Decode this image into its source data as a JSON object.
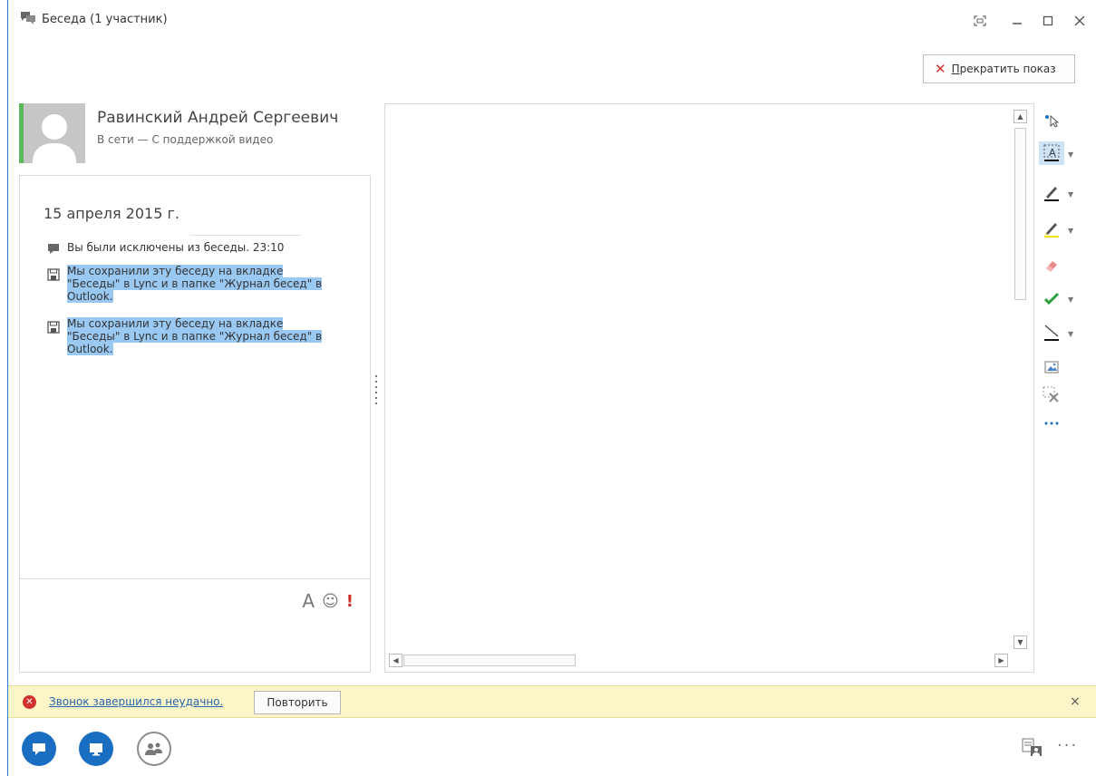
{
  "window": {
    "title": "Беседа (1 участник)"
  },
  "header": {
    "stop_presenting_label": "Прекратить показ",
    "stop_presenting_mnemonic": "П",
    "stop_presenting_rest": "рекратить показ"
  },
  "contact": {
    "name": "Равинский Андрей Сергеевич",
    "status": "В сети — С поддержкой видео",
    "presence_color": "#5cb85c"
  },
  "conversation": {
    "date": "15 апреля 2015 г.",
    "messages": [
      {
        "icon": "chat-bubble-icon",
        "text": "Вы были исключены из беседы. 23:10",
        "highlighted": false
      },
      {
        "icon": "save-icon",
        "line1": "Мы сохранили эту беседу на вкладке",
        "line2": "\"Беседы\" в Lync и в папке \"Журнал бесед\" в",
        "line3": "Outlook.",
        "highlighted": true
      },
      {
        "icon": "save-icon",
        "line1": "Мы сохранили эту беседу на вкладке",
        "line2": "\"Беседы\" в Lync и в папке \"Журнал бесед\" в",
        "line3": "Outlook.",
        "highlighted": true
      }
    ],
    "input_tools": {
      "font": "A",
      "emoji": "☺",
      "importance": "!"
    }
  },
  "whiteboard_tools": [
    {
      "name": "select-pointer-icon"
    },
    {
      "name": "text-tool-icon",
      "selected": true,
      "has_dropdown": true
    },
    {
      "name": "pen-tool-icon",
      "has_dropdown": true
    },
    {
      "name": "highlighter-tool-icon",
      "has_dropdown": true
    },
    {
      "name": "eraser-tool-icon"
    },
    {
      "name": "stamp-check-icon",
      "has_dropdown": true
    },
    {
      "name": "line-tool-icon",
      "has_dropdown": true
    },
    {
      "name": "insert-image-icon"
    },
    {
      "name": "delete-selection-icon"
    },
    {
      "name": "more-tools-icon"
    }
  ],
  "notification": {
    "message": "Звонок завершился неудачно.",
    "retry_label": "Повторить",
    "close": "×",
    "status_color": "#d0312d",
    "background": "#fcf5c8"
  },
  "bottom_bar": {
    "more": "···"
  },
  "colors": {
    "accent": "#1a6ec1",
    "highlight": "#99c9f2",
    "window_border": "#2b7cd3"
  }
}
